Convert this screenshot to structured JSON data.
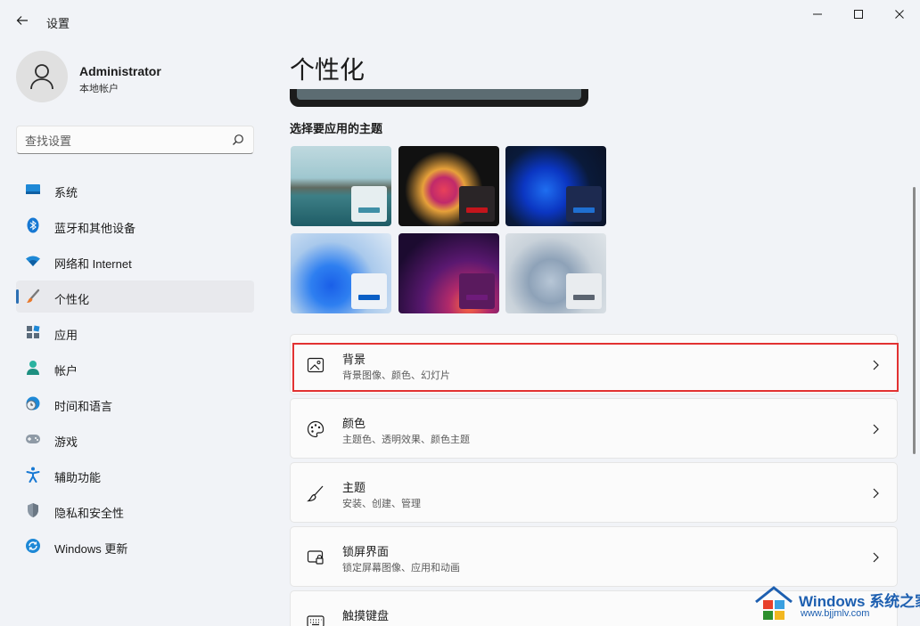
{
  "window": {
    "app_title": "设置",
    "controls": [
      "minimize-icon",
      "maximize-icon",
      "close-icon"
    ]
  },
  "profile": {
    "name": "Administrator",
    "account_type": "本地帐户"
  },
  "search": {
    "placeholder": "查找设置",
    "icon": "search-icon"
  },
  "sidebar": {
    "items": [
      {
        "label": "系统",
        "icon": "system-icon",
        "active": false
      },
      {
        "label": "蓝牙和其他设备",
        "icon": "bluetooth-icon",
        "active": false
      },
      {
        "label": "网络和 Internet",
        "icon": "wifi-icon",
        "active": false
      },
      {
        "label": "个性化",
        "icon": "brush-icon",
        "active": true
      },
      {
        "label": "应用",
        "icon": "apps-icon",
        "active": false
      },
      {
        "label": "帐户",
        "icon": "account-icon",
        "active": false
      },
      {
        "label": "时间和语言",
        "icon": "clock-globe-icon",
        "active": false
      },
      {
        "label": "游戏",
        "icon": "gamepad-icon",
        "active": false
      },
      {
        "label": "辅助功能",
        "icon": "accessibility-icon",
        "active": false
      },
      {
        "label": "隐私和安全性",
        "icon": "shield-icon",
        "active": false
      },
      {
        "label": "Windows 更新",
        "icon": "update-icon",
        "active": false
      }
    ]
  },
  "main": {
    "page_title": "个性化",
    "theme_heading": "选择要应用的主题",
    "themes": [
      {
        "name": "glow-lake",
        "accent": "#3f8fa6"
      },
      {
        "name": "captured-motion",
        "accent": "#c4151c"
      },
      {
        "name": "windows-dark",
        "accent": "#1f6fd1"
      },
      {
        "name": "windows-light",
        "accent": "#0a5fc6"
      },
      {
        "name": "sunrise",
        "accent": "#6e1b7a"
      },
      {
        "name": "flow",
        "accent": "#5b6470"
      }
    ],
    "cards": [
      {
        "title": "背景",
        "subtitle": "背景图像、颜色、幻灯片",
        "icon": "image-icon",
        "highlighted": true
      },
      {
        "title": "颜色",
        "subtitle": "主题色、透明效果、颜色主题",
        "icon": "palette-icon",
        "highlighted": false
      },
      {
        "title": "主题",
        "subtitle": "安装、创建、管理",
        "icon": "brush-icon",
        "highlighted": false
      },
      {
        "title": "锁屏界面",
        "subtitle": "锁定屏幕图像、应用和动画",
        "icon": "lockscreen-icon",
        "highlighted": false
      },
      {
        "title": "触摸键盘",
        "subtitle": "",
        "icon": "keyboard-icon",
        "highlighted": false
      }
    ]
  },
  "watermark": {
    "brand": "Windows",
    "brand_cn": "系统之家",
    "url": "www.bjjmlv.com"
  },
  "colors": {
    "accent": "#2b6fb3",
    "highlight_border": "#e23232",
    "background": "#f1f3f7"
  }
}
